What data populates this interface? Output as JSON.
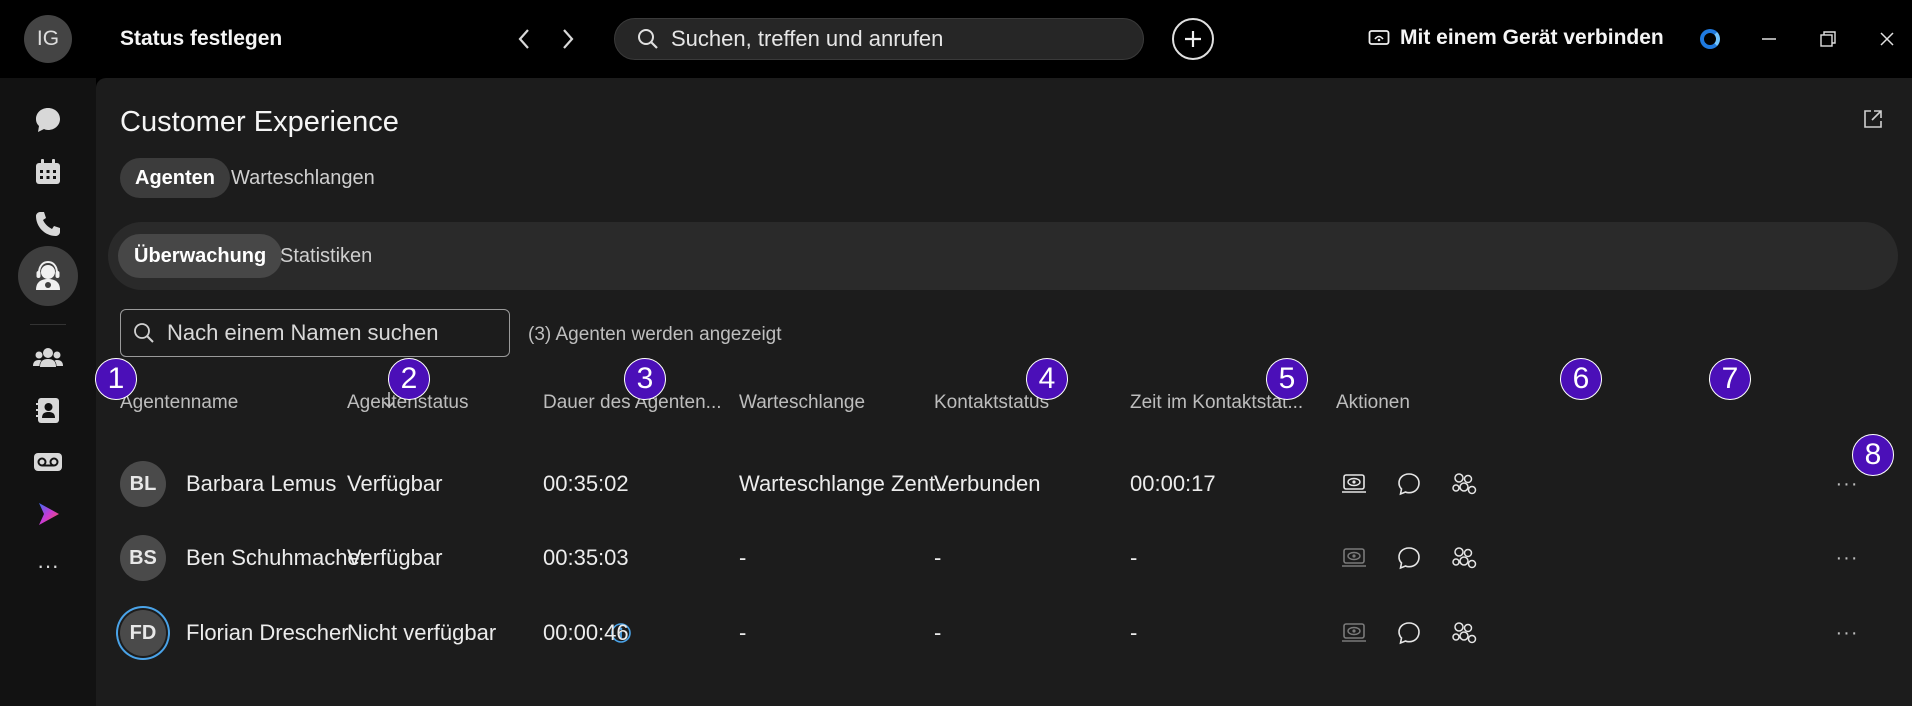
{
  "titlebar": {
    "avatar_initials": "IG",
    "set_status": "Status festlegen",
    "search_placeholder": "Suchen, treffen und anrufen",
    "connect_device": "Mit einem Gerät verbinden"
  },
  "rail": {
    "items": [
      "chat-icon",
      "calendar-icon",
      "phone-icon",
      "customer-experience-icon",
      "teams-icon",
      "contacts-icon",
      "voicemail-icon",
      "webex-app-icon",
      "more-icon"
    ],
    "more_label": "···"
  },
  "page": {
    "title": "Customer Experience",
    "tabs": [
      "Agenten",
      "Warteschlangen"
    ],
    "subtabs": [
      "Überwachung",
      "Statistiken"
    ],
    "name_search_placeholder": "Nach einem Namen suchen",
    "agent_count": "(3) Agenten werden angezeigt"
  },
  "table": {
    "columns": [
      "Agentenname",
      "Agentenstatus",
      "Dauer des Agenten...",
      "Warteschlange",
      "Kontaktstatus",
      "Zeit im Kontaktstat...",
      "Aktionen"
    ],
    "rows": [
      {
        "initials": "BL",
        "name": "Barbara Lemus",
        "status": "Verfügbar",
        "duration": "00:35:02",
        "queue": "Warteschlange Zent...",
        "contact_status": "Verbunden",
        "contact_time": "00:00:17",
        "more": "···"
      },
      {
        "initials": "BS",
        "name": "Ben Schuhmacher",
        "status": "Verfügbar",
        "duration": "00:35:03",
        "queue": "-",
        "contact_status": "-",
        "contact_time": "-",
        "more": "···"
      },
      {
        "initials": "FD",
        "name": "Florian Drescher",
        "status": "Nicht verfügbar",
        "duration": "00:00:46",
        "queue": "-",
        "contact_status": "-",
        "contact_time": "-",
        "more": "···"
      }
    ]
  },
  "badges": [
    "1",
    "2",
    "3",
    "4",
    "5",
    "6",
    "7",
    "8"
  ],
  "colors": {
    "badge": "#4b0fb8",
    "accent_ring": "#4aa3e8",
    "info": "#4aa3e8",
    "spinner": "#1f7ae0"
  }
}
